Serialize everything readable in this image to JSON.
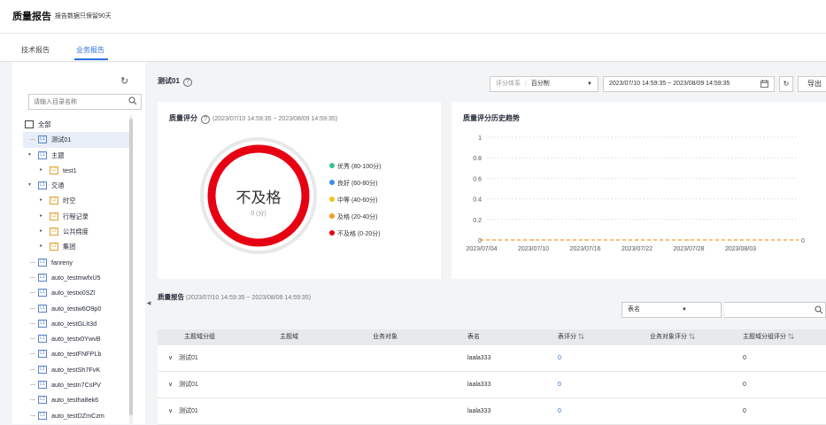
{
  "header": {
    "title": "质量报告",
    "subtitle": "报告数据只保留90天"
  },
  "tabs": [
    {
      "label": "技术报告"
    },
    {
      "label": "业务报告"
    }
  ],
  "sidebar": {
    "search_placeholder": "请输入目录名称",
    "tree": [
      {
        "label": "全部",
        "badge": ""
      },
      {
        "label": "测试01",
        "badge": "L1"
      },
      {
        "label": "主题",
        "badge": "L1"
      },
      {
        "label": "test1",
        "badge": "L2"
      },
      {
        "label": "交通",
        "badge": "L1"
      },
      {
        "label": "时空",
        "badge": "L2"
      },
      {
        "label": "行程记录",
        "badge": "L2"
      },
      {
        "label": "公共绵度",
        "badge": "L2"
      },
      {
        "label": "集团",
        "badge": "L2"
      },
      {
        "label": "fanreny",
        "badge": "L1"
      },
      {
        "label": "auto_testmwfxU5",
        "badge": "L1"
      },
      {
        "label": "auto_testxi0SZl",
        "badge": "L1"
      },
      {
        "label": "auto_testw6O9p0",
        "badge": "L1"
      },
      {
        "label": "auto_testGLIt3d",
        "badge": "L1"
      },
      {
        "label": "auto_testx0YwvB",
        "badge": "L1"
      },
      {
        "label": "auto_testFNFPLb",
        "badge": "L1"
      },
      {
        "label": "auto_testSh7FvK",
        "badge": "L1"
      },
      {
        "label": "auto_testn7CsPV",
        "badge": "L1"
      },
      {
        "label": "auto_testha8ek6",
        "badge": "L1"
      },
      {
        "label": "auto_testDZmCzm",
        "badge": "L1"
      }
    ]
  },
  "main": {
    "title": "测试01",
    "rating_system": {
      "label": "评分体系",
      "value": "百分制"
    },
    "date_range": "2023/07/10 14:59:35 ~ 2023/08/09 14:59:35",
    "export_label": "导出"
  },
  "score_card": {
    "title": "质量评分",
    "range": "(2023/07/10 14:59:35 ~ 2023/08/09 14:59:35)",
    "grade": "不及格",
    "score": "0 (分)",
    "ring_color": "#e60012",
    "legend": [
      {
        "label": "优秀 (80-100分)",
        "color": "#3cc28c"
      },
      {
        "label": "良好 (60-80分)",
        "color": "#3d8eea"
      },
      {
        "label": "中等 (40-60分)",
        "color": "#f5c21b"
      },
      {
        "label": "及格 (20-40分)",
        "color": "#f59a23"
      },
      {
        "label": "不及格 (0-20分)",
        "color": "#e60012"
      }
    ]
  },
  "chart_data": {
    "type": "line",
    "title": "质量评分历史趋势",
    "x": [
      "2023/07/04",
      "2023/07/10",
      "2023/07/16",
      "2023/07/22",
      "2023/07/28",
      "2023/08/03"
    ],
    "yticks": [
      "1",
      "0.8",
      "0.6",
      "0.4",
      "0.2",
      "0"
    ],
    "ylim": [
      0,
      1
    ],
    "series": [
      {
        "values": [
          0,
          0,
          0,
          0,
          0,
          0
        ],
        "color": "#f59a23"
      }
    ],
    "end_label": "0",
    "grid": true
  },
  "report": {
    "title": "质量报告",
    "range": "(2023/07/10 14:59:35 ~ 2023/08/09 14:59:35)",
    "filter_label": "表名",
    "columns": [
      "主题域分组",
      "主题域",
      "业务对象",
      "表名",
      "表评分",
      "业务对象评分",
      "主题域分组评分"
    ],
    "rows": [
      {
        "group": "测试01",
        "domain": "",
        "object": "",
        "table": "laala333",
        "table_score": "0",
        "object_score": "",
        "group_score": "0"
      },
      {
        "group": "测试01",
        "domain": "",
        "object": "",
        "table": "laala333",
        "table_score": "0",
        "object_score": "",
        "group_score": "0"
      },
      {
        "group": "测试01",
        "domain": "",
        "object": "",
        "table": "laala333",
        "table_score": "0",
        "object_score": "",
        "group_score": "0"
      }
    ]
  }
}
